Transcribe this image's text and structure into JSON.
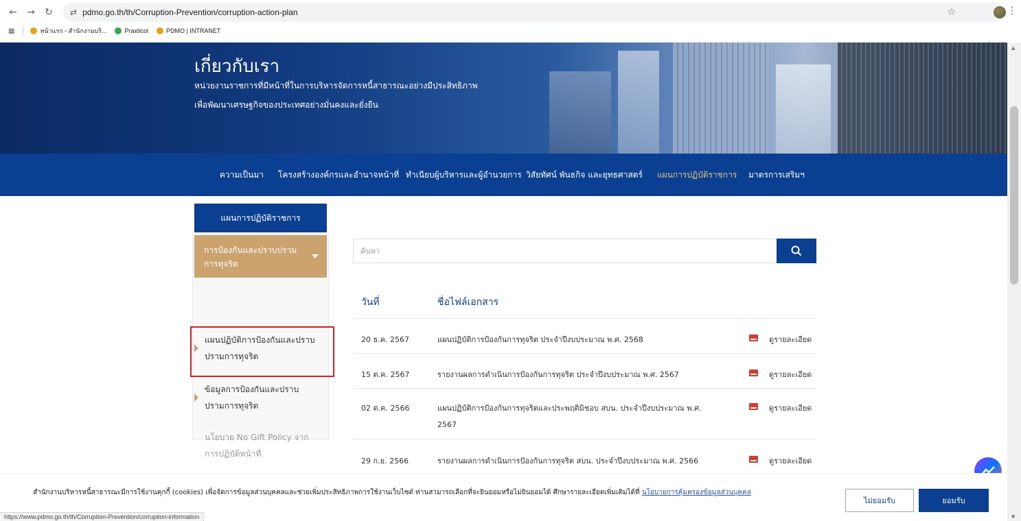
{
  "browser": {
    "url": "pdmo.go.th/th/Corruption-Prevention/corruption-action-plan",
    "bookmarks": [
      "หน้าแรก - สำนักงานบริ...",
      "Praxticol",
      "PDMO | INTRANET"
    ],
    "status_url": "https://www.pdmo.go.th/th/Corruption-Prevention/corruption-information"
  },
  "hero": {
    "title": "เกี่ยวกับเรา",
    "subtitle_1": "หน่วยงานราชการที่มีหน้าที่ในการบริหารจัดการหนี้สาธารณะอย่างมีประสิทธิภาพ",
    "subtitle_2": "เพื่อพัฒนาเศรษฐกิจของประเทศอย่างมั่นคงและยั่งยืน"
  },
  "topnav": {
    "items": [
      "ความเป็นมา",
      "โครงสร้างองค์กรและอำนาจหน้าที่",
      "ทำเนียบผู้บริหารและผู้อำนวยการ",
      "วิสัยทัศน์ พันธกิจ และยุทธศาสตร์",
      "แผนการปฏิบัติราชการ",
      "มาตรการเสริมฯ"
    ],
    "active_index": 4
  },
  "sidebar": {
    "header": "แผนการปฏิบัติราชการ",
    "category": "การป้องกันและปราบปรามการทุจริต",
    "items": [
      "แผนปฏิบัติการป้องกันและปราบปรามการทุจริต",
      "ข้อมูลการป้องกันและปราบปรามการทุจริต",
      "นโยบาย No Gift Policy จากการปฏิบัติหน้าที่"
    ]
  },
  "search": {
    "placeholder": "ค้นหา"
  },
  "table": {
    "headers": [
      "วันที่",
      "ชื่อไฟล์เอกสาร"
    ],
    "detail_label": "ดูรายละเอียด",
    "rows": [
      {
        "date": "20 ธ.ค. 2567",
        "title": "แผนปฏิบัติการป้องกันการทุจริต ประจำปีงบประมาณ พ.ศ. 2568"
      },
      {
        "date": "15 ต.ค. 2567",
        "title": "รายงานผลการดำเนินการป้องกันการทุจริต ประจำปีงบประมาณ พ.ศ. 2567"
      },
      {
        "date": "02 ต.ค. 2566",
        "title": "แผนปฏิบัติการป้องกันการทุจริตและประพฤติมิชอบ สบน. ประจำปีงบประมาณ พ.ศ.",
        "title_line2": "2567"
      },
      {
        "date": "29 ก.ย. 2566",
        "title": "รายงานผลการดำเนินการป้องกันการทุจริต สบน. ประจำปีงบประมาณ พ.ศ. 2566"
      }
    ]
  },
  "cookie": {
    "text": "สำนักงานบริหารหนี้สาธารณะมีการใช้งานคุกกี้ (cookies) เพื่อจัดการข้อมูลส่วนบุคคลและช่วยเพิ่มประสิทธิภาพการใช้งานเว็บไซต์ ท่านสามารถเลือกที่จะยินยอมหรือไม่ยินยอมได้  ศึกษารายละเอียดเพิ่มเติมได้ที่ ",
    "link": "นโยบายการคุ้มครองข้อมูลส่วนบุคคล",
    "decline": "ไม่ยอมรับ",
    "accept": "ยอมรับ"
  },
  "colors": {
    "primary": "#0b3f91",
    "gold": "#caa36e",
    "active_nav": "#e3c27d",
    "highlight": "#e02020"
  }
}
